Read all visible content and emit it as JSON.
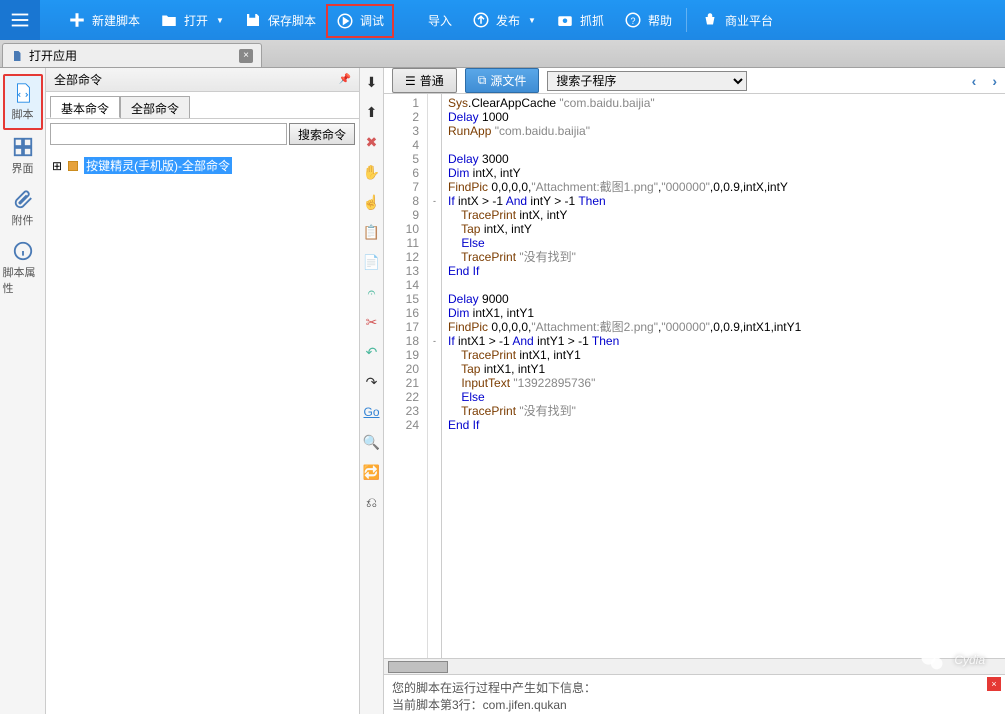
{
  "toolbar": {
    "new": "新建脚本",
    "open": "打开",
    "save": "保存脚本",
    "debug": "调试",
    "import": "导入",
    "publish": "发布",
    "capture": "抓抓",
    "help": "帮助",
    "biz": "商业平台"
  },
  "tab": {
    "title": "打开应用"
  },
  "leftbar": {
    "script": "脚本",
    "ui": "界面",
    "attach": "附件",
    "props": "脚本属性"
  },
  "cmdpanel": {
    "title": "全部命令",
    "tab_basic": "基本命令",
    "tab_all": "全部命令",
    "search_btn": "搜索命令",
    "tree_root": "按键精灵(手机版)-全部命令"
  },
  "editor_tabs": {
    "normal": "普通",
    "source": "源文件"
  },
  "search_placeholder": "搜索子程序",
  "code": [
    {
      "n": 1,
      "t": [
        [
          "f",
          "Sys"
        ],
        [
          "n",
          ".ClearAppCache "
        ],
        [
          "s",
          "\"com.baidu.baijia\""
        ]
      ]
    },
    {
      "n": 2,
      "t": [
        [
          "k",
          "Delay"
        ],
        [
          "n",
          " 1000"
        ]
      ]
    },
    {
      "n": 3,
      "t": [
        [
          "f",
          "RunApp"
        ],
        [
          "n",
          " "
        ],
        [
          "s",
          "\"com.baidu.baijia\""
        ]
      ]
    },
    {
      "n": 4,
      "t": []
    },
    {
      "n": 5,
      "t": [
        [
          "k",
          "Delay"
        ],
        [
          "n",
          " 3000"
        ]
      ]
    },
    {
      "n": 6,
      "t": [
        [
          "k",
          "Dim"
        ],
        [
          "n",
          " intX, intY"
        ]
      ]
    },
    {
      "n": 7,
      "t": [
        [
          "f",
          "FindPic"
        ],
        [
          "n",
          " 0,0,0,0,"
        ],
        [
          "s",
          "\"Attachment:截图1.png\""
        ],
        [
          "n",
          ","
        ],
        [
          "s",
          "\"000000\""
        ],
        [
          "n",
          ",0,0.9,intX,intY"
        ]
      ]
    },
    {
      "n": 8,
      "f": "-",
      "t": [
        [
          "k",
          "If"
        ],
        [
          "n",
          " intX > -1 "
        ],
        [
          "k",
          "And"
        ],
        [
          "n",
          " intY > -1 "
        ],
        [
          "k",
          "Then"
        ]
      ]
    },
    {
      "n": 9,
      "t": [
        [
          "n",
          "    "
        ],
        [
          "f",
          "TracePrint"
        ],
        [
          "n",
          " intX, intY"
        ]
      ]
    },
    {
      "n": 10,
      "t": [
        [
          "n",
          "    "
        ],
        [
          "f",
          "Tap"
        ],
        [
          "n",
          " intX, intY"
        ]
      ]
    },
    {
      "n": 11,
      "t": [
        [
          "n",
          "    "
        ],
        [
          "k",
          "Else"
        ]
      ]
    },
    {
      "n": 12,
      "t": [
        [
          "n",
          "    "
        ],
        [
          "f",
          "TracePrint"
        ],
        [
          "n",
          " "
        ],
        [
          "s",
          "\"没有找到\""
        ]
      ]
    },
    {
      "n": 13,
      "t": [
        [
          "k",
          "End If"
        ]
      ]
    },
    {
      "n": 14,
      "t": []
    },
    {
      "n": 15,
      "t": [
        [
          "k",
          "Delay"
        ],
        [
          "n",
          " 9000"
        ]
      ]
    },
    {
      "n": 16,
      "t": [
        [
          "k",
          "Dim"
        ],
        [
          "n",
          " intX1, intY1"
        ]
      ]
    },
    {
      "n": 17,
      "t": [
        [
          "f",
          "FindPic"
        ],
        [
          "n",
          " 0,0,0,0,"
        ],
        [
          "s",
          "\"Attachment:截图2.png\""
        ],
        [
          "n",
          ","
        ],
        [
          "s",
          "\"000000\""
        ],
        [
          "n",
          ",0,0.9,intX1,intY1"
        ]
      ]
    },
    {
      "n": 18,
      "f": "-",
      "t": [
        [
          "k",
          "If"
        ],
        [
          "n",
          " intX1 > -1 "
        ],
        [
          "k",
          "And"
        ],
        [
          "n",
          " intY1 > -1 "
        ],
        [
          "k",
          "Then"
        ]
      ]
    },
    {
      "n": 19,
      "t": [
        [
          "n",
          "    "
        ],
        [
          "f",
          "TracePrint"
        ],
        [
          "n",
          " intX1, intY1"
        ]
      ]
    },
    {
      "n": 20,
      "t": [
        [
          "n",
          "    "
        ],
        [
          "f",
          "Tap"
        ],
        [
          "n",
          " intX1, intY1"
        ]
      ]
    },
    {
      "n": 21,
      "t": [
        [
          "n",
          "    "
        ],
        [
          "f",
          "InputText"
        ],
        [
          "n",
          " "
        ],
        [
          "s",
          "\"13922895736\""
        ]
      ]
    },
    {
      "n": 22,
      "t": [
        [
          "n",
          "    "
        ],
        [
          "k",
          "Else"
        ]
      ]
    },
    {
      "n": 23,
      "t": [
        [
          "n",
          "    "
        ],
        [
          "f",
          "TracePrint"
        ],
        [
          "n",
          " "
        ],
        [
          "s",
          "\"没有找到\""
        ]
      ]
    },
    {
      "n": 24,
      "t": [
        [
          "k",
          "End If"
        ]
      ]
    }
  ],
  "console": {
    "l1": "您的脚本在运行过程中产生如下信息：",
    "l2": "当前脚本第3行：com.jifen.qukan"
  },
  "watermark": "Cydia"
}
